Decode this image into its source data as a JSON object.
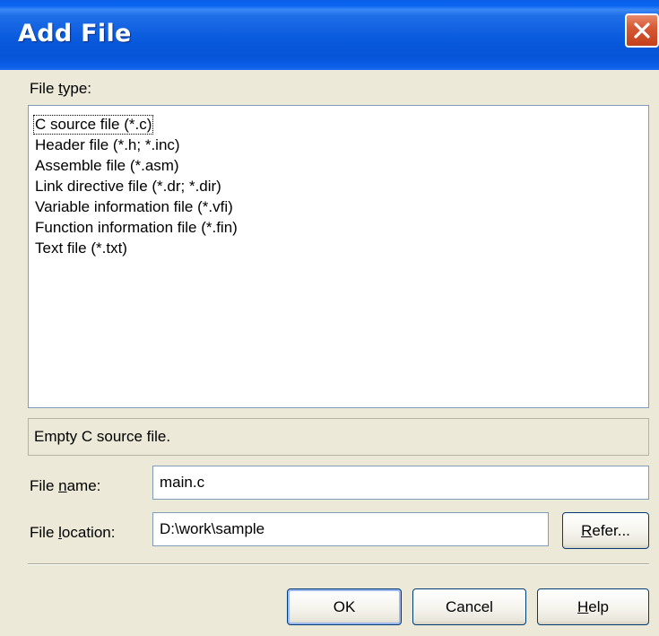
{
  "dialog": {
    "title": "Add File",
    "close_icon": "close-icon"
  },
  "file_type": {
    "label_prefix": "File ",
    "label_accel": "t",
    "label_suffix": "ype:",
    "items": [
      "C source file (*.c)",
      "Header file (*.h; *.inc)",
      "Assemble file (*.asm)",
      "Link directive file (*.dr; *.dir)",
      "Variable information file (*.vfi)",
      "Function information file (*.fin)",
      "Text file (*.txt)"
    ],
    "selected_index": 0
  },
  "description": "Empty C source file.",
  "file_name": {
    "label_prefix": "File ",
    "label_accel": "n",
    "label_suffix": "ame:",
    "value": "main.c"
  },
  "file_location": {
    "label_prefix": "File ",
    "label_accel": "l",
    "label_suffix": "ocation:",
    "value": "D:\\work\\sample",
    "refer_accel": "R",
    "refer_suffix": "efer..."
  },
  "buttons": {
    "ok": "OK",
    "cancel": "Cancel",
    "help_accel": "H",
    "help_suffix": "elp"
  }
}
